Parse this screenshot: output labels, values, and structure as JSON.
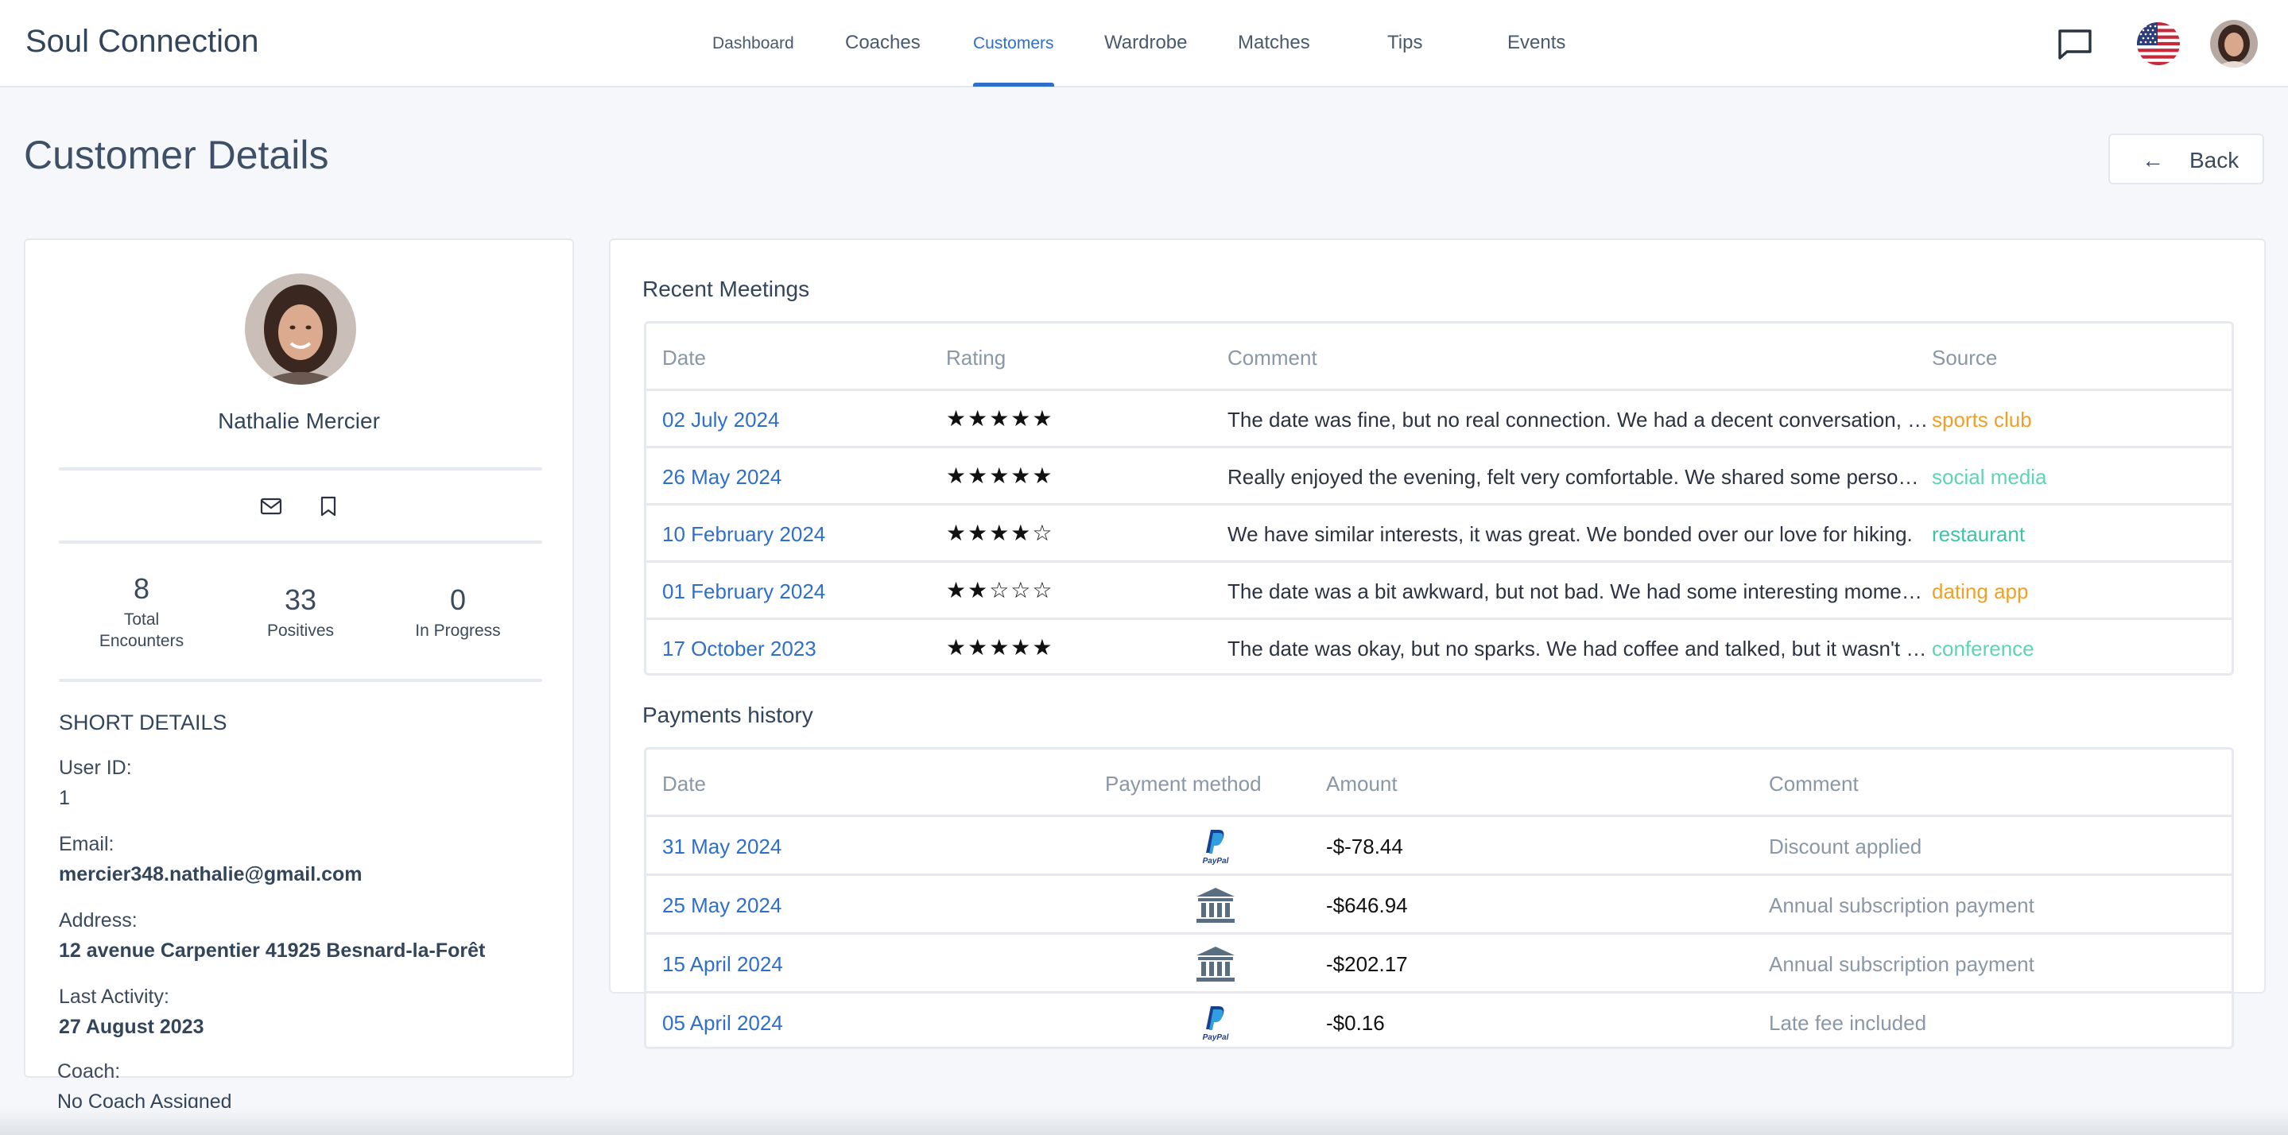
{
  "app": {
    "brand": "Soul Connection"
  },
  "nav": {
    "items": [
      {
        "label": "Dashboard"
      },
      {
        "label": "Coaches"
      },
      {
        "label": "Customers"
      },
      {
        "label": "Wardrobe"
      },
      {
        "label": "Matches"
      },
      {
        "label": "Tips"
      },
      {
        "label": "Events"
      }
    ],
    "active": "Customers",
    "icons": [
      "chat-icon",
      "us-flag-icon",
      "avatar"
    ]
  },
  "page": {
    "title": "Customer Details",
    "back_label": "Back"
  },
  "profile": {
    "name": "Nathalie Mercier",
    "actions": [
      "mail-icon",
      "bookmark-icon"
    ],
    "stats": [
      {
        "value": "8",
        "label": "Total Encounters"
      },
      {
        "value": "33",
        "label": "Positives"
      },
      {
        "value": "0",
        "label": "In Progress"
      }
    ],
    "short_details_title": "SHORT DETAILS",
    "details": {
      "user_id_label": "User ID:",
      "user_id": "1",
      "email_label": "Email:",
      "email": "mercier348.nathalie@gmail.com",
      "address_label": "Address:",
      "address": "12 avenue Carpentier 41925 Besnard-la-Forêt",
      "last_activity_label": "Last Activity:",
      "last_activity": "27 August 2023",
      "coach_label": "Coach:",
      "coach": "No Coach Assigned"
    }
  },
  "meetings": {
    "title": "Recent Meetings",
    "headers": {
      "date": "Date",
      "rating": "Rating",
      "comment": "Comment",
      "source": "Source"
    },
    "rows": [
      {
        "date": "02 July 2024",
        "rating": "★★★★★",
        "rating_value": 5,
        "comment": "The date was fine, but no real connection. We had a decent conversation, but it lacked spark.",
        "source": "sports club",
        "source_color": "#f0a028"
      },
      {
        "date": "26 May 2024",
        "rating": "★★★★★",
        "rating_value": 5,
        "comment": "Really enjoyed the evening, felt very comfortable. We shared some personal stories.",
        "source": "social media",
        "source_color": "#5fd3b5"
      },
      {
        "date": "10 February 2024",
        "rating": "★★★★☆",
        "rating_value": 4,
        "comment": "We have similar interests, it was great. We bonded over our love for hiking.",
        "source": "restaurant",
        "source_color": "#3fc3a8"
      },
      {
        "date": "01 February 2024",
        "rating": "★★☆☆☆",
        "rating_value": 2,
        "comment": "The date was a bit awkward, but not bad. We had some interesting moments.",
        "source": "dating app",
        "source_color": "#f0a028"
      },
      {
        "date": "17 October 2023",
        "rating": "★★★★★",
        "rating_value": 5,
        "comment": "The date was okay, but no sparks. We had coffee and talked, but it wasn't special.",
        "source": "conference",
        "source_color": "#5fd3b5"
      }
    ]
  },
  "payments": {
    "title": "Payments history",
    "headers": {
      "date": "Date",
      "method": "Payment method",
      "amount": "Amount",
      "comment": "Comment"
    },
    "rows": [
      {
        "date": "31 May 2024",
        "method": "paypal-icon",
        "paypal_text": "PayPal",
        "amount": "-$-78.44",
        "comment": "Discount applied"
      },
      {
        "date": "25 May 2024",
        "method": "bank-icon",
        "amount": "-$646.94",
        "comment": "Annual subscription payment"
      },
      {
        "date": "15 April 2024",
        "method": "bank-icon",
        "amount": "-$202.17",
        "comment": "Annual subscription payment"
      },
      {
        "date": "05 April 2024",
        "method": "paypal-icon",
        "paypal_text": "PayPal",
        "amount": "-$0.16",
        "comment": "Late fee included"
      }
    ]
  },
  "colors": {
    "accent": "#2f6fcb",
    "title": "#3e5068",
    "muted": "#8a97a7",
    "border": "#e6e9ef"
  }
}
